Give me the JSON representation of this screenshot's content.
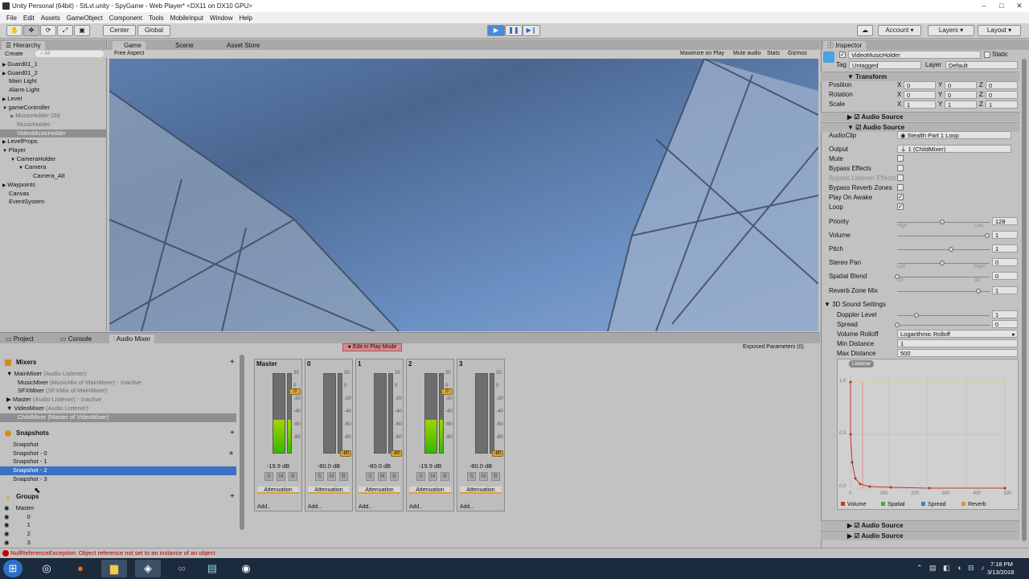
{
  "window": {
    "title": "Unity Personal (64bit) - StLvl.unity - SpyGame - Web Player* <DX11 on DX10 GPU>"
  },
  "menu": [
    "File",
    "Edit",
    "Assets",
    "GameObject",
    "Component",
    "Tools",
    "MobileInput",
    "Window",
    "Help"
  ],
  "toolbar": {
    "center": "Center",
    "global": "Global",
    "account": "Account",
    "layers": "Layers",
    "layout": "Layout"
  },
  "hierarchy": {
    "tab": "Hierarchy",
    "create": "Create",
    "search_placeholder": "All",
    "items": [
      {
        "label": "Guard01_1"
      },
      {
        "label": "Guard01_2"
      },
      {
        "label": "Main Light"
      },
      {
        "label": "Alarm Light"
      },
      {
        "label": "Level"
      },
      {
        "label": "gameController"
      },
      {
        "label": "MusicHolder Old"
      },
      {
        "label": "MusicHolder"
      },
      {
        "label": "VideoMusicHolder"
      },
      {
        "label": "LevelProps"
      },
      {
        "label": "Player"
      },
      {
        "label": "CameraHolder"
      },
      {
        "label": "Camera"
      },
      {
        "label": "Camera_Alt"
      },
      {
        "label": "Waypoints"
      },
      {
        "label": "Canvas"
      },
      {
        "label": "EventSystem"
      }
    ]
  },
  "game_view": {
    "tabs": [
      "Game",
      "Scene",
      "Asset Store"
    ],
    "aspect": "Free Aspect",
    "options": [
      "Maximize on Play",
      "Mute audio",
      "Stats",
      "Gizmos"
    ]
  },
  "bottom_tabs": [
    "Project",
    "Console",
    "Audio Mixer"
  ],
  "mixer": {
    "edit_in_play": "Edit in Play Mode",
    "exposed": "Exposed Parameters (0)",
    "mixers_title": "Mixers",
    "mixers": [
      {
        "name": "MainMixer",
        "note": "(Audio Listener)"
      },
      {
        "name": "MusicMixer",
        "note": "(MusicMix of MainMixer) - Inactive"
      },
      {
        "name": "SFXMixer",
        "note": "(SFXMix of MainMixer)"
      },
      {
        "name": "Master",
        "note": "(Audio Listener) - Inactive"
      },
      {
        "name": "VideoMixer",
        "note": "(Audio Listener)"
      },
      {
        "name": "ChildMixer",
        "note": "(Master of VideoMixer)"
      }
    ],
    "snapshots_title": "Snapshots",
    "snapshots": [
      "Snapshot",
      "Snapshot - 0",
      "Snapshot - 1",
      "Snapshot - 2",
      "Snapshot - 3"
    ],
    "groups_title": "Groups",
    "groups": [
      "Master",
      "0",
      "1",
      "2",
      "3"
    ],
    "channels": [
      {
        "name": "Master",
        "db": "-19.9 dB",
        "attenuation": "Attenuation",
        "add": "Add..",
        "level": 0.42
      },
      {
        "name": "0",
        "db": "-80.0 dB",
        "attenuation": "Attenuation",
        "add": "Add..",
        "level": 0.0
      },
      {
        "name": "1",
        "db": "-80.0 dB",
        "attenuation": "Attenuation",
        "add": "Add..",
        "level": 0.0
      },
      {
        "name": "2",
        "db": "-19.9 dB",
        "attenuation": "Attenuation",
        "add": "Add..",
        "level": 0.42
      },
      {
        "name": "3",
        "db": "-80.0 dB",
        "attenuation": "Attenuation",
        "add": "Add..",
        "level": 0.0
      }
    ],
    "smb": [
      "S",
      "M",
      "B"
    ],
    "scale": [
      "20",
      "0",
      "-20",
      "-40",
      "-60",
      "-80"
    ],
    "handle_zero": "0",
    "handle_min": "-80"
  },
  "inspector": {
    "tab": "Inspector",
    "object_name": "VideoMusicHolder",
    "static": "Static",
    "tag_label": "Tag",
    "tag": "Untagged",
    "layer_label": "Layer",
    "layer": "Default",
    "transform": {
      "title": "Transform",
      "rows": [
        {
          "label": "Position",
          "x": "0",
          "y": "0",
          "z": "0"
        },
        {
          "label": "Rotation",
          "x": "0",
          "y": "0",
          "z": "0"
        },
        {
          "label": "Scale",
          "x": "1",
          "y": "1",
          "z": "1"
        }
      ],
      "axes": [
        "X",
        "Y",
        "Z"
      ]
    },
    "audio_source_title": "Audio Source",
    "audioclip_label": "AudioClip",
    "audioclip": "Stealth Part 1 Loop",
    "output_label": "Output",
    "output": "1 (ChildMixer)",
    "checks": [
      {
        "label": "Mute",
        "checked": false
      },
      {
        "label": "Bypass Effects",
        "checked": false
      },
      {
        "label": "Bypass Listener Effects",
        "checked": false
      },
      {
        "label": "Bypass Reverb Zones",
        "checked": false
      },
      {
        "label": "Play On Awake",
        "checked": true
      },
      {
        "label": "Loop",
        "checked": true
      }
    ],
    "sliders": [
      {
        "label": "Priority",
        "value": "128",
        "pos": 0.5,
        "left": "High",
        "right": "Low"
      },
      {
        "label": "Volume",
        "value": "1",
        "pos": 1.0,
        "left": "",
        "right": ""
      },
      {
        "label": "Pitch",
        "value": "1",
        "pos": 0.6,
        "left": "",
        "right": ""
      },
      {
        "label": "Stereo Pan",
        "value": "0",
        "pos": 0.5,
        "left": "Left",
        "right": "Right"
      },
      {
        "label": "Spatial Blend",
        "value": "0",
        "pos": 0.0,
        "left": "2D",
        "right": "3D"
      },
      {
        "label": "Reverb Zone Mix",
        "value": "1",
        "pos": 0.9,
        "left": "",
        "right": ""
      }
    ],
    "sound3d": {
      "title": "3D Sound Settings",
      "doppler_label": "Doppler Level",
      "doppler": "1",
      "doppler_pos": 0.2,
      "spread_label": "Spread",
      "spread": "0",
      "rolloff_label": "Volume Rolloff",
      "rolloff": "Logarithmic Rolloff",
      "min_label": "Min Distance",
      "min": "1",
      "max_label": "Max Distance",
      "max": "500"
    },
    "graph": {
      "listener": "Listener",
      "y_ticks": [
        "1.0",
        "0.5",
        "0.0"
      ],
      "x_ticks": [
        "0",
        "100",
        "200",
        "300",
        "400",
        "500"
      ],
      "legend": [
        "Volume",
        "Spatial",
        "Spread",
        "Reverb"
      ],
      "legend_colors": [
        "#c0392b",
        "#5aa02c",
        "#3f7fbf",
        "#c8a030"
      ]
    }
  },
  "status": {
    "error": "NullReferenceException: Object reference not set to an instance of an object"
  },
  "taskbar": {
    "time": "7:18 PM",
    "date": "3/13/2018"
  }
}
